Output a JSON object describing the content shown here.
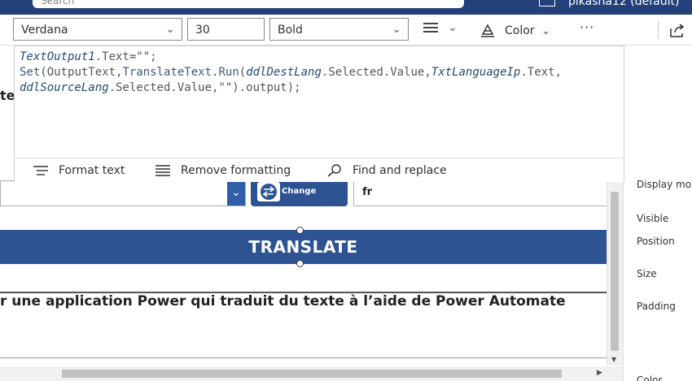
{
  "header": {
    "search_placeholder": "Search",
    "environment": "pikasha12 (default)"
  },
  "toolbar": {
    "font": "Verdana",
    "size": "30",
    "weight": "Bold",
    "color_label": "Color",
    "more": "···"
  },
  "formula": {
    "lines": [
      [
        {
          "t": "TextOutput1",
          "c": "id"
        },
        {
          "t": ".Text=\"\";",
          "c": "pr"
        }
      ],
      [
        {
          "t": "Set",
          "c": "fn"
        },
        {
          "t": "(OutputText,",
          "c": "pr"
        },
        {
          "t": "TranslateText",
          "c": "fn"
        },
        {
          "t": ".",
          "c": "pr"
        },
        {
          "t": "Run",
          "c": "fn"
        },
        {
          "t": "(",
          "c": "pr"
        },
        {
          "t": "ddlDestLang",
          "c": "id"
        },
        {
          "t": ".Selected.Value,",
          "c": "pr"
        },
        {
          "t": "TxtLanguageIp",
          "c": "id"
        },
        {
          "t": ".Text,",
          "c": "pr"
        }
      ],
      [
        {
          "t": "ddlSourceLang",
          "c": "id"
        },
        {
          "t": ".Selected.Value,\"\").output);",
          "c": "pr"
        }
      ]
    ],
    "actions": {
      "format": "Format text",
      "remove": "Remove formatting",
      "find": "Find and replace"
    }
  },
  "canvas": {
    "left_fragment": "te",
    "change_label": "Change",
    "lang_value": "fr",
    "translate_title": "TRANSLATE",
    "description": "r une application Power qui traduit du texte à l’aide de Power Automate"
  },
  "properties": {
    "display_mode": "Display mo",
    "visible": "Visible",
    "position": "Position",
    "size": "Size",
    "padding": "Padding",
    "color": "Color"
  },
  "colors": {
    "banner": "#24407a",
    "accent": "#2e5393"
  }
}
